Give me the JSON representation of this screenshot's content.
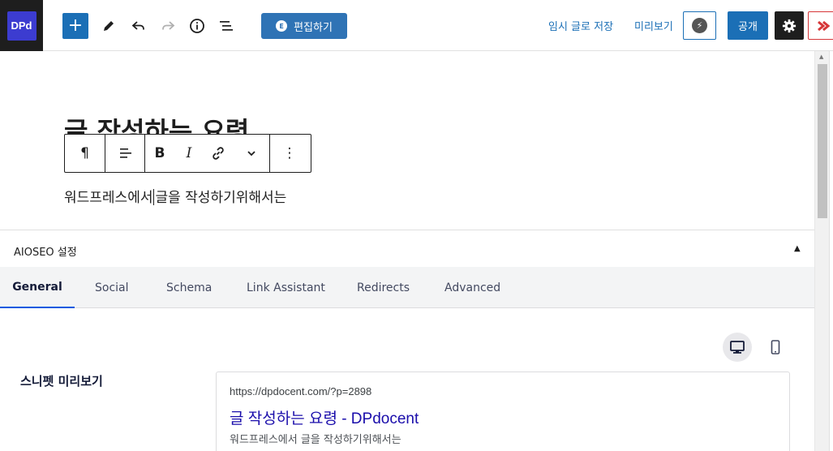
{
  "logo": {
    "text": "DPd"
  },
  "toolbar": {
    "add_icon": "plus-icon",
    "edit_elementor_label": "편집하기",
    "save_draft_label": "임시 글로 저장",
    "preview_label": "미리보기",
    "publish_label": "공개"
  },
  "editor": {
    "title": "글 작성하는 요령",
    "paragraph_before_caret": "워드프레스에서",
    "paragraph_after_caret": "글을 작성하기위해서는"
  },
  "aioseo": {
    "panel_title": "AIOSEO 설정",
    "tabs": [
      {
        "label": "General",
        "active": true
      },
      {
        "label": "Social",
        "active": false
      },
      {
        "label": "Schema",
        "active": false
      },
      {
        "label": "Link Assistant",
        "active": false
      },
      {
        "label": "Redirects",
        "active": false
      },
      {
        "label": "Advanced",
        "active": false
      }
    ],
    "snippet_label": "스니펫 미리보기",
    "snippet": {
      "url": "https://dpdocent.com/?p=2898",
      "title": "글 작성하는 요령 - DPdocent",
      "description": "워드프레스에서 글을 작성하기위해서는"
    }
  },
  "colors": {
    "wp_blue": "#1b6fb6",
    "elementor_blue": "#2f73b5",
    "logo_bg": "#3c3cd0",
    "tab_active_underline": "#005ae0",
    "snippet_title": "#1a0dab",
    "aioseo_red": "#d63638"
  }
}
